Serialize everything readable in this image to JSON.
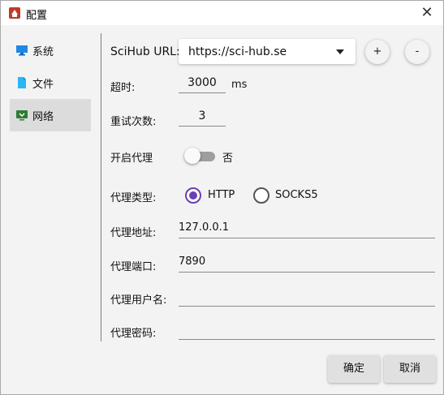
{
  "window": {
    "title": "配置",
    "close_glyph": "✕"
  },
  "sidebar": {
    "items": [
      {
        "label": "系统",
        "icon": "monitor-icon",
        "active": false
      },
      {
        "label": "文件",
        "icon": "file-icon",
        "active": false
      },
      {
        "label": "网络",
        "icon": "network-icon",
        "active": true
      }
    ]
  },
  "form": {
    "scihub_label": "SciHub URL:",
    "scihub_value": "https://sci-hub.se",
    "add_label": "+",
    "remove_label": "-",
    "timeout_label": "超时:",
    "timeout_value": "3000",
    "timeout_unit": "ms",
    "retry_label": "重试次数:",
    "retry_value": "3",
    "proxy_enable_label": "开启代理",
    "proxy_enable_state": "否",
    "proxy_type_label": "代理类型:",
    "proxy_type_options": [
      "HTTP",
      "SOCKS5"
    ],
    "proxy_type_selected": "HTTP",
    "proxy_host_label": "代理地址:",
    "proxy_host_value": "127.0.0.1",
    "proxy_port_label": "代理端口:",
    "proxy_port_value": "7890",
    "proxy_user_label": "代理用户名:",
    "proxy_user_value": "",
    "proxy_password_label": "代理密码:",
    "proxy_password_value": ""
  },
  "footer": {
    "ok_label": "确定",
    "cancel_label": "取消"
  },
  "colors": {
    "accent": "#6a3fb5",
    "toggle_off": "#9e9e9e",
    "sidebar_active": "#dcdcdc"
  }
}
